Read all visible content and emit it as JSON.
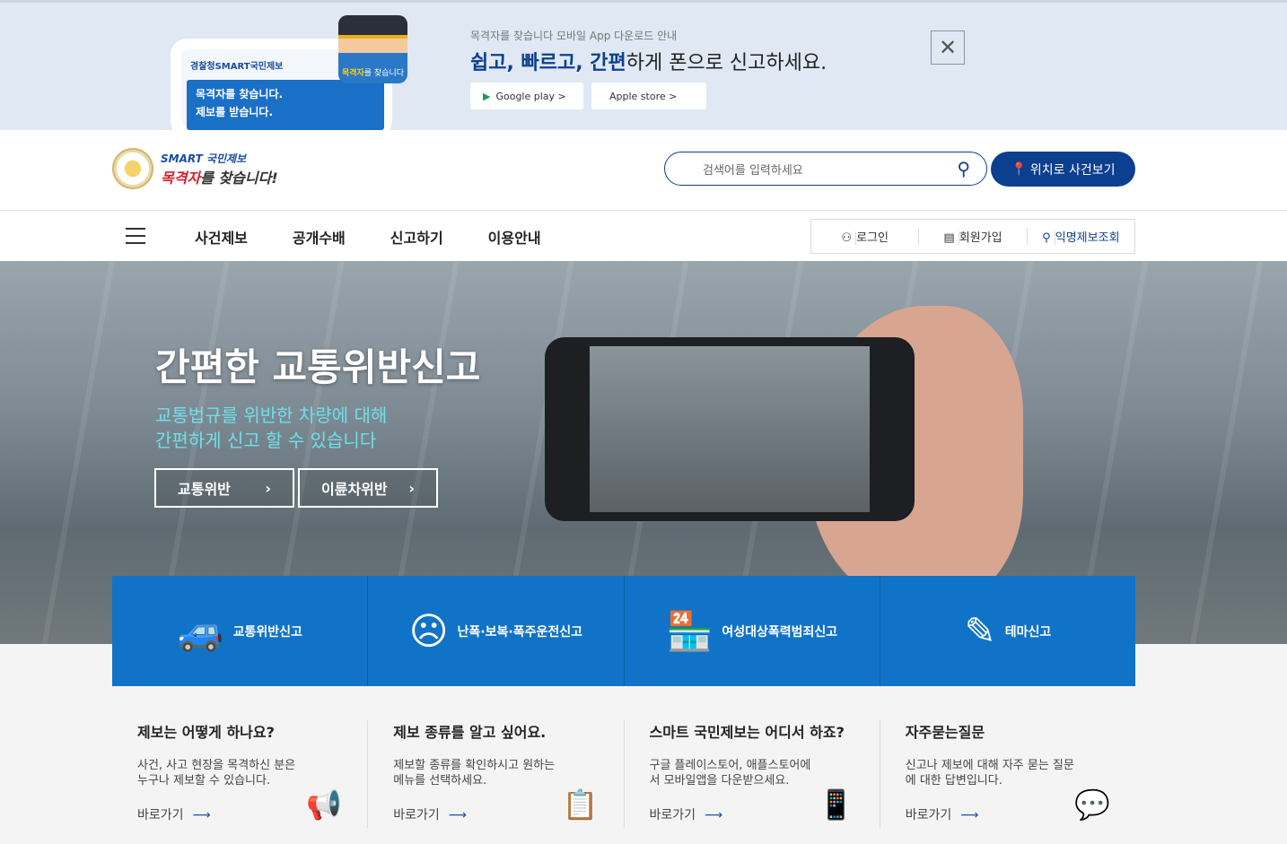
{
  "banner": {
    "phone_brand": "경찰청SMART국민제보",
    "phone_line1": "목격자를 찾습니다.",
    "phone_line2": "제보를 받습니다.",
    "mascot_strong": "목격자",
    "mascot_rest": "를 찾습니다",
    "subtitle": "목격자를 찾습니다 모바일 App 다운로드 안내",
    "title_b1": "쉽고, 빠르고, 간편",
    "title_r1": "하게 폰으로 신고하세요.",
    "google": "Google play >",
    "apple": "Apple store >",
    "close": "✕"
  },
  "header": {
    "logo_line1": "SMART 국민제보",
    "logo_strong": "목격자",
    "logo_rest": "를 찾습니다!",
    "search_placeholder": "검색어를 입력하세요",
    "location_btn": "위치로 사건보기"
  },
  "nav": {
    "items": [
      "사건제보",
      "공개수배",
      "신고하기",
      "이용안내"
    ],
    "login": "로그인",
    "join": "회원가입",
    "anon": "익명제보조회"
  },
  "hero": {
    "title": "간편한 교통위반신고",
    "sub1": "교통법규를 위반한 차량에 대해",
    "sub2": "간편하게 신고 할 수 있습니다",
    "btn1": "교통위반",
    "btn2": "이륜차위반"
  },
  "cards": [
    "교통위반신고",
    "난폭·보복·폭주운전신고",
    "여성대상폭력범죄신고",
    "테마신고"
  ],
  "faq": [
    {
      "title": "제보는 어떻게 하나요?",
      "desc": "사건, 사고 현장을 목격하신 분은 누구나 제보할 수 있습니다.",
      "go": "바로가기"
    },
    {
      "title": "제보 종류를 알고 싶어요.",
      "desc": "제보할 종류를 확인하시고 원하는 메뉴를 선택하세요.",
      "go": "바로가기"
    },
    {
      "title": "스마트 국민제보는 어디서 하죠?",
      "desc": "구글 플레이스토어, 애플스토어에서 모바일앱을 다운받으세요.",
      "go": "바로가기"
    },
    {
      "title": "자주묻는질문",
      "desc": "신고나 제보에 대해 자주 묻는 질문에 대한 답변입니다.",
      "go": "바로가기"
    }
  ]
}
